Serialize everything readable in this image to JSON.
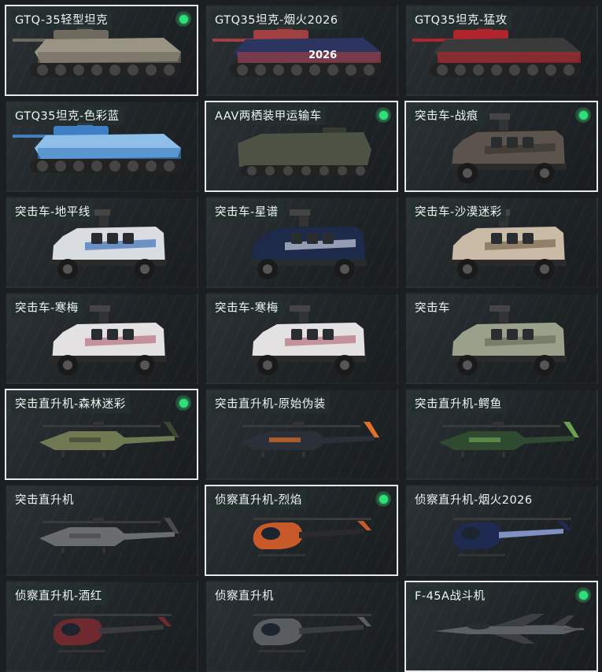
{
  "tank_colors": {
    "gtq35": "#9a9484",
    "fireworks": "#2c3560",
    "fierce": "#3a3a3a",
    "colorblue": "#7fb6e6"
  },
  "cards": [
    {
      "title": "GTQ-35轻型坦克",
      "type": "tank",
      "selected": true,
      "equipped": true,
      "color": "#9a9484",
      "accent": "#6f6a5f",
      "badge": "",
      "plain": false
    },
    {
      "title": "GTQ35坦克-烟火2026",
      "type": "tank",
      "selected": false,
      "equipped": false,
      "color": "#2c3560",
      "accent": "#a04040",
      "badge": "2026",
      "plain": false
    },
    {
      "title": "GTQ35坦克-猛攻",
      "type": "tank",
      "selected": false,
      "equipped": false,
      "color": "#3a3a3a",
      "accent": "#b0252b",
      "badge": "",
      "plain": false
    },
    {
      "title": "GTQ35坦克-色彩蓝",
      "type": "tank",
      "selected": false,
      "equipped": false,
      "color": "#8fbfe8",
      "accent": "#3f7fc4",
      "badge": "",
      "plain": false
    },
    {
      "title": "AAV两栖装甲运输车",
      "type": "aav",
      "selected": true,
      "equipped": true,
      "color": "#4c5244",
      "accent": "#363b31",
      "badge": "",
      "plain": false
    },
    {
      "title": "突击车-战痕",
      "type": "truck",
      "selected": true,
      "equipped": true,
      "color": "#5c544c",
      "accent": "#3a3532",
      "badge": "",
      "plain": false
    },
    {
      "title": "突击车-地平线",
      "type": "truck",
      "selected": false,
      "equipped": false,
      "color": "#d9dde2",
      "accent": "#3d70b8",
      "badge": "",
      "plain": false
    },
    {
      "title": "突击车-星谱",
      "type": "truck",
      "selected": false,
      "equipped": false,
      "color": "#1e2a4a",
      "accent": "#c8cfe0",
      "badge": "",
      "plain": false
    },
    {
      "title": "突击车-沙漠迷彩",
      "type": "truck",
      "selected": false,
      "equipped": false,
      "color": "#c9bba6",
      "accent": "#7a6650",
      "badge": "",
      "plain": false
    },
    {
      "title": "突击车-寒梅",
      "type": "truck",
      "selected": false,
      "equipped": false,
      "color": "#e4e1e2",
      "accent": "#b5707c",
      "badge": "",
      "plain": false
    },
    {
      "title": "突击车-寒梅",
      "type": "truck",
      "selected": false,
      "equipped": false,
      "color": "#e4e1e2",
      "accent": "#b5707c",
      "badge": "",
      "plain": false
    },
    {
      "title": "突击车",
      "type": "truck",
      "selected": false,
      "equipped": false,
      "color": "#9aa08a",
      "accent": "#6a6f5c",
      "badge": "",
      "plain": true
    },
    {
      "title": "突击直升机-森林迷彩",
      "type": "heli",
      "selected": true,
      "equipped": true,
      "color": "#6f7a52",
      "accent": "#3e4530",
      "badge": "",
      "plain": false
    },
    {
      "title": "突击直升机-原始伪装",
      "type": "heli",
      "selected": false,
      "equipped": false,
      "color": "#2a2f38",
      "accent": "#e0702a",
      "badge": "",
      "plain": false
    },
    {
      "title": "突击直升机-鳄鱼",
      "type": "heli",
      "selected": false,
      "equipped": false,
      "color": "#2f4a30",
      "accent": "#6aa050",
      "badge": "",
      "plain": false
    },
    {
      "title": "突击直升机",
      "type": "heli",
      "selected": false,
      "equipped": false,
      "color": "#6a6d70",
      "accent": "#48494b",
      "badge": "",
      "plain": true
    },
    {
      "title": "侦察直升机-烈焰",
      "type": "scout",
      "selected": true,
      "equipped": true,
      "color": "#c85a2a",
      "accent": "#2a2a2a",
      "badge": "",
      "plain": false
    },
    {
      "title": "侦察直升机-烟火2026",
      "type": "scout",
      "selected": false,
      "equipped": false,
      "color": "#1e2a50",
      "accent": "#8090c0",
      "badge": "",
      "plain": true
    },
    {
      "title": "侦察直升机-酒红",
      "type": "scout",
      "selected": false,
      "equipped": false,
      "color": "#6e2a2e",
      "accent": "#3a3a3a",
      "badge": "",
      "plain": false
    },
    {
      "title": "侦察直升机",
      "type": "scout",
      "selected": false,
      "equipped": false,
      "color": "#5a5d60",
      "accent": "#3a3b3c",
      "badge": "",
      "plain": true
    },
    {
      "title": "F-45A战斗机",
      "type": "jet",
      "selected": true,
      "equipped": true,
      "color": "#5c6066",
      "accent": "#3c3f44",
      "badge": "",
      "plain": false
    }
  ]
}
